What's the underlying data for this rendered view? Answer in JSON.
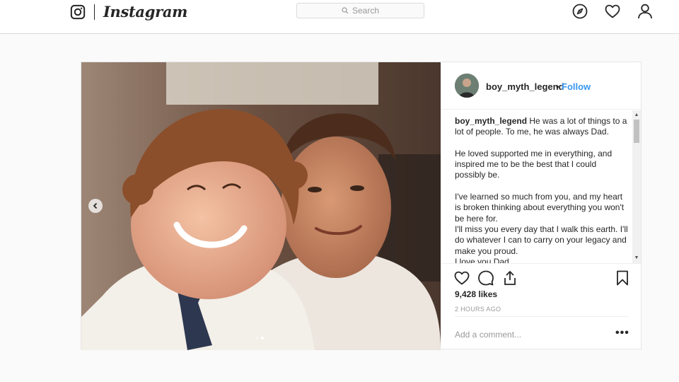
{
  "header": {
    "brand": "Instagram",
    "search_placeholder": "Search",
    "icons": [
      "instagram-glyph-icon",
      "search-icon",
      "compass-icon",
      "heart-icon",
      "profile-icon"
    ]
  },
  "post": {
    "username": "boy_myth_legend",
    "separator": "•",
    "follow_label": "Follow",
    "caption": {
      "username": "boy_myth_legend",
      "paragraphs": [
        "He was a lot of things to a lot of people. To me, he was always Dad.",
        "He loved supported me in everything, and inspired me to be the best that I could possibly be.",
        "I've learned so much from you, and my heart is broken thinking about everything you won't be here for.",
        "I'll miss you every day that I walk this earth. I'll do whatever I can to carry on your legacy and make you proud.",
        "I love you Dad."
      ]
    },
    "likes": "9,428 likes",
    "timestamp": "2 HOURS AGO",
    "comment_placeholder": "Add a comment...",
    "more_label": "•••",
    "carousel": {
      "count": 2,
      "active_index": 1
    },
    "action_icons": [
      "like-heart-icon",
      "comment-bubble-icon",
      "share-icon",
      "bookmark-icon"
    ]
  },
  "colors": {
    "background": "#fafafa",
    "border": "#dbdbdb",
    "link_blue": "#3897f0",
    "text": "#262626",
    "muted": "#999999"
  }
}
